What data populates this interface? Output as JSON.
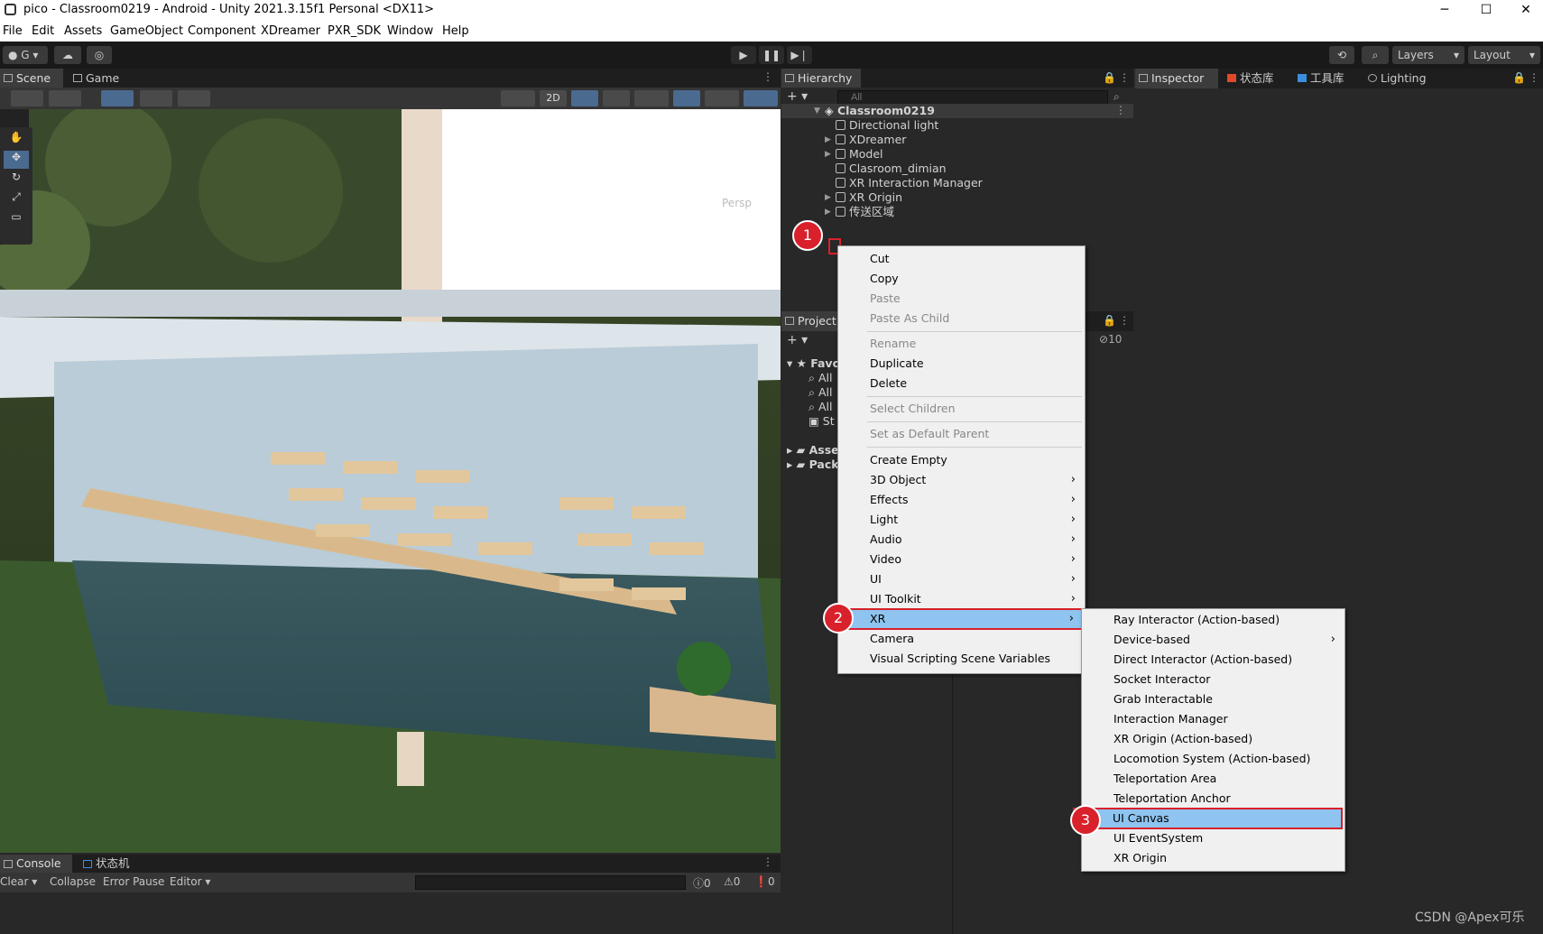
{
  "window": {
    "title": "pico - Classroom0219 - Android - Unity 2021.3.15f1 Personal <DX11>",
    "minimize": "─",
    "maximize": "☐",
    "close": "✕"
  },
  "menubar": [
    "File",
    "Edit",
    "Assets",
    "GameObject",
    "Component",
    "XDreamer",
    "PXR_SDK",
    "Window",
    "Help"
  ],
  "toolbar": {
    "account": "G",
    "layers": "Layers",
    "layout": "Layout"
  },
  "scene_tabs": {
    "scene": "Scene",
    "game": "Game"
  },
  "scene": {
    "toggle_2d": "2D",
    "persp": "Persp"
  },
  "hierarchy": {
    "tab": "Hierarchy",
    "search_placeholder": "All",
    "scene_name": "Classroom0219",
    "items": [
      "Directional light",
      "XDreamer",
      "Model",
      "Clasroom_dimian",
      "XR Interaction Manager",
      "XR Origin",
      "传送区域"
    ]
  },
  "project": {
    "tab": "Project",
    "hidden_count": "10",
    "items": [
      "Favo",
      "All",
      "All",
      "All",
      "St",
      "Asse",
      "Pack"
    ]
  },
  "inspector_tabs": [
    "Inspector",
    "状态库",
    "工具库",
    "Lighting"
  ],
  "context_menu": {
    "items": [
      {
        "label": "Cut",
        "enabled": true
      },
      {
        "label": "Copy",
        "enabled": true
      },
      {
        "label": "Paste",
        "enabled": false
      },
      {
        "label": "Paste As Child",
        "enabled": false
      },
      {
        "label": "Rename",
        "enabled": false
      },
      {
        "label": "Duplicate",
        "enabled": true
      },
      {
        "label": "Delete",
        "enabled": true
      },
      {
        "label": "Select Children",
        "enabled": false
      },
      {
        "label": "Set as Default Parent",
        "enabled": false
      },
      {
        "label": "Create Empty",
        "enabled": true
      },
      {
        "label": "3D Object",
        "enabled": true
      },
      {
        "label": "Effects",
        "enabled": true
      },
      {
        "label": "Light",
        "enabled": true
      },
      {
        "label": "Audio",
        "enabled": true
      },
      {
        "label": "Video",
        "enabled": true
      },
      {
        "label": "UI",
        "enabled": true
      },
      {
        "label": "UI Toolkit",
        "enabled": true
      },
      {
        "label": "XR",
        "enabled": true
      },
      {
        "label": "Camera",
        "enabled": true
      },
      {
        "label": "Visual Scripting Scene Variables",
        "enabled": true
      }
    ],
    "submenu_arrow": "›"
  },
  "xr_submenu": {
    "items": [
      "Ray Interactor (Action-based)",
      "Device-based",
      "Direct Interactor (Action-based)",
      "Socket Interactor",
      "Grab Interactable",
      "Interaction Manager",
      "XR Origin (Action-based)",
      "Locomotion System (Action-based)",
      "Teleportation Area",
      "Teleportation Anchor",
      "UI Canvas",
      "UI EventSystem",
      "XR Origin"
    ]
  },
  "badges": [
    "1",
    "2",
    "3"
  ],
  "console": {
    "tab": "Console",
    "tab2": "状态机",
    "clear": "Clear",
    "collapse": "Collapse",
    "error_pause": "Error Pause",
    "editor": "Editor",
    "errors": "0",
    "warnings": "0",
    "logs": "0"
  },
  "watermark": "CSDN @Apex可乐",
  "colors": {
    "highlight": "#8ec4ef",
    "annotation_red": "#d9212b"
  }
}
